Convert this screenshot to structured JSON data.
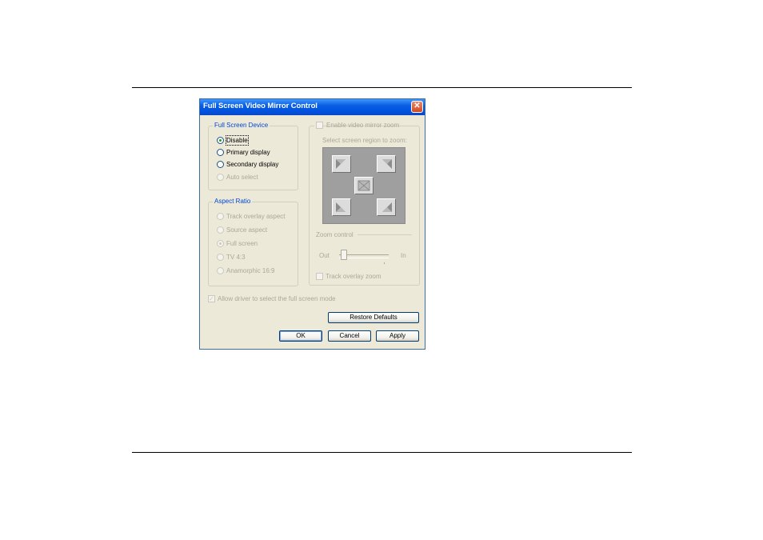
{
  "window": {
    "title": "Full Screen Video Mirror Control",
    "close_glyph": "✕"
  },
  "full_screen_device": {
    "label": "Full Screen Device",
    "options": [
      {
        "label": "Disable",
        "selected": true,
        "enabled": true
      },
      {
        "label": "Primary display",
        "selected": false,
        "enabled": true
      },
      {
        "label": "Secondary display",
        "selected": false,
        "enabled": true
      },
      {
        "label": "Auto select",
        "selected": false,
        "enabled": false
      }
    ]
  },
  "aspect_ratio": {
    "label": "Aspect Ratio",
    "options": [
      {
        "label": "Track overlay aspect",
        "selected": false,
        "enabled": false
      },
      {
        "label": "Source aspect",
        "selected": false,
        "enabled": false
      },
      {
        "label": "Full screen",
        "selected": true,
        "enabled": false
      },
      {
        "label": "TV 4:3",
        "selected": false,
        "enabled": false
      },
      {
        "label": "Anamorphic 16:9",
        "selected": false,
        "enabled": false
      }
    ]
  },
  "mirror_zoom": {
    "enable_label": "Enable video mirror zoom",
    "enabled": false,
    "region_label": "Select screen region to zoom:",
    "region_buttons": [
      "top-left-arrow-icon",
      "top-right-arrow-icon",
      "center-icon",
      "bottom-left-arrow-icon",
      "bottom-right-arrow-icon"
    ],
    "zoom_control_label": "Zoom control",
    "slider_min_label": "Out",
    "slider_max_label": "In",
    "slider_level": 0,
    "track_overlay_zoom_label": "Track overlay zoom",
    "track_overlay_zoom_checked": false
  },
  "allow_driver": {
    "label": "Allow driver to select the full screen mode",
    "checked": true,
    "enabled": false
  },
  "buttons": {
    "restore_defaults": "Restore Defaults",
    "ok": "OK",
    "cancel": "Cancel",
    "apply": "Apply"
  },
  "colors": {
    "titlebar": "#0054e3",
    "dialog_bg": "#ece9d8",
    "group_label_blue": "#0046d5",
    "disabled_text": "#aca899"
  }
}
